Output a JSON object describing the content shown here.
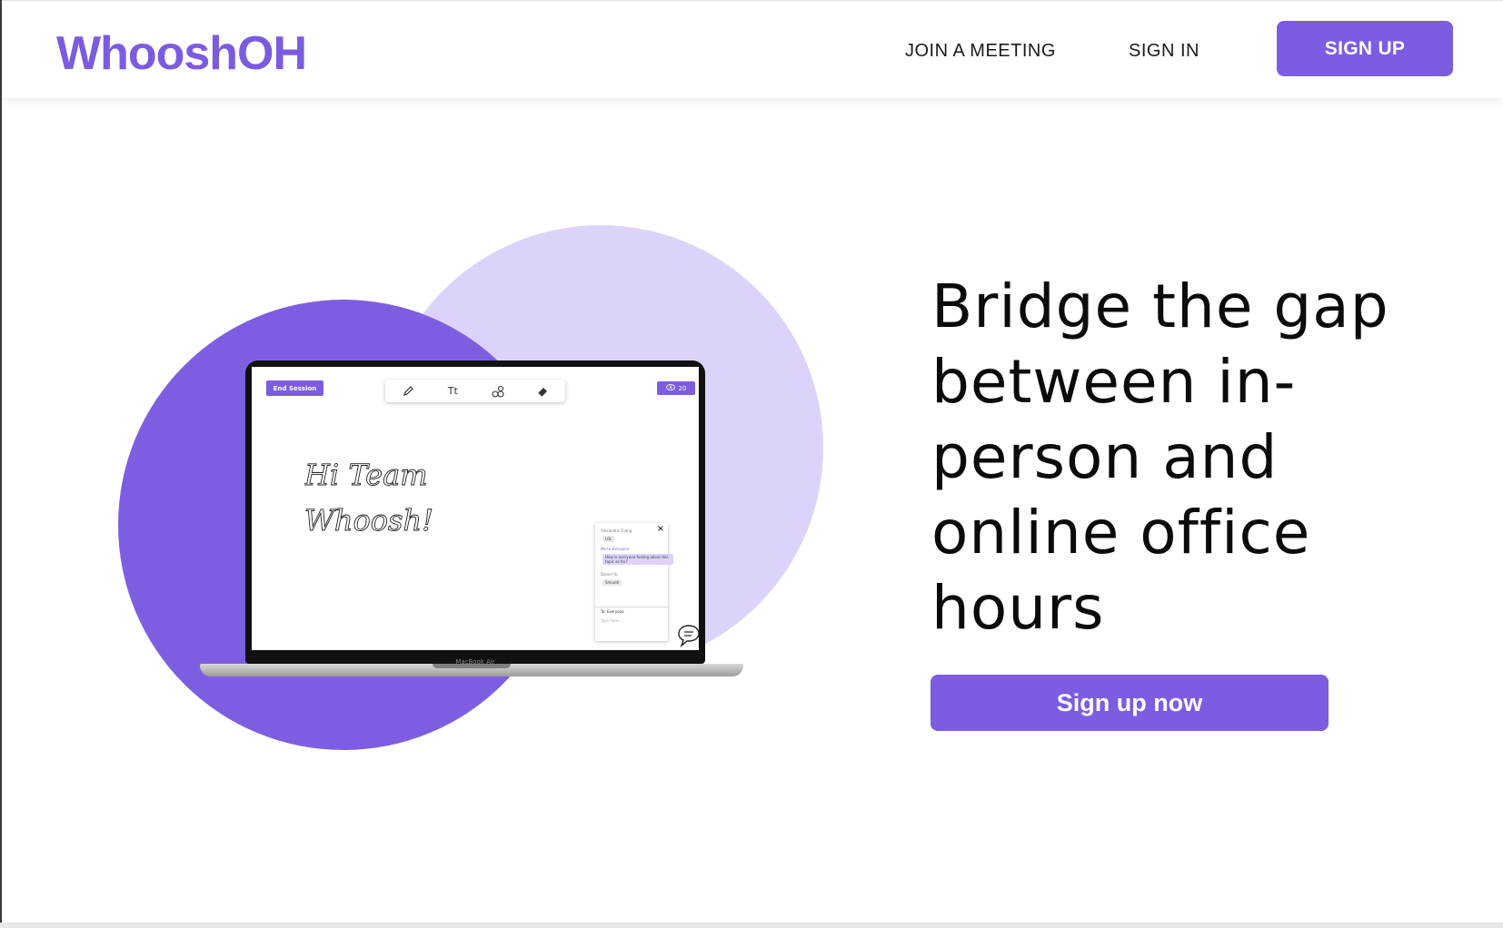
{
  "colors": {
    "brand": "#7c5ce0",
    "brand_light": "#ddd3fa",
    "text": "#0b0b0b"
  },
  "header": {
    "logo": "WhooshOH",
    "nav": {
      "join": "JOIN A MEETING",
      "signin": "SIGN IN",
      "signup": "SIGN UP"
    }
  },
  "hero": {
    "title": "Bridge the gap between in-person and online office hours",
    "cta": "Sign up now"
  },
  "mockup": {
    "end_session": "End Session",
    "viewer_count": "20",
    "tools": [
      "pencil-icon",
      "text-icon",
      "shapes-icon",
      "eraser-icon"
    ],
    "text_tool_label": "Tt",
    "handwriting": [
      "Hi Team",
      "Whoosh!"
    ],
    "laptop_brand": "MacBook Air",
    "chat": {
      "messages": [
        {
          "name": "Alexandra Chang",
          "text": "LOL"
        },
        {
          "name": "Me to Everyone",
          "text": "How is everyone feeling about this topic so far?"
        },
        {
          "name": "Daniel Yu",
          "text": "Smooth"
        }
      ],
      "to_label": "To: Everyone",
      "input_placeholder": "Type here..."
    }
  }
}
